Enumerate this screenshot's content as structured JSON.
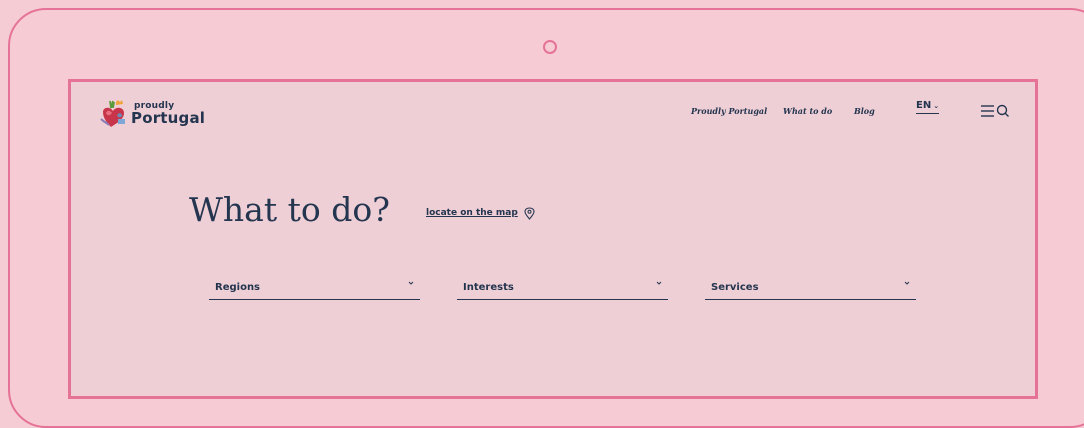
{
  "brand": {
    "logo_small": "proudly",
    "logo_big": "Portugal"
  },
  "nav": {
    "links": [
      {
        "label": "Proudly Portugal"
      },
      {
        "label": "What to do"
      },
      {
        "label": "Blog"
      }
    ],
    "language": "EN",
    "menu_icon": "hamburger-icon",
    "search_icon": "search-icon"
  },
  "main": {
    "title": "What to do?",
    "map_link": "locate on the map",
    "map_icon": "map-pin-icon"
  },
  "filters": [
    {
      "label": "Regions"
    },
    {
      "label": "Interests"
    },
    {
      "label": "Services"
    }
  ],
  "colors": {
    "background": "#f6cbd3",
    "device_outline": "#e57398",
    "text": "#24354f"
  }
}
